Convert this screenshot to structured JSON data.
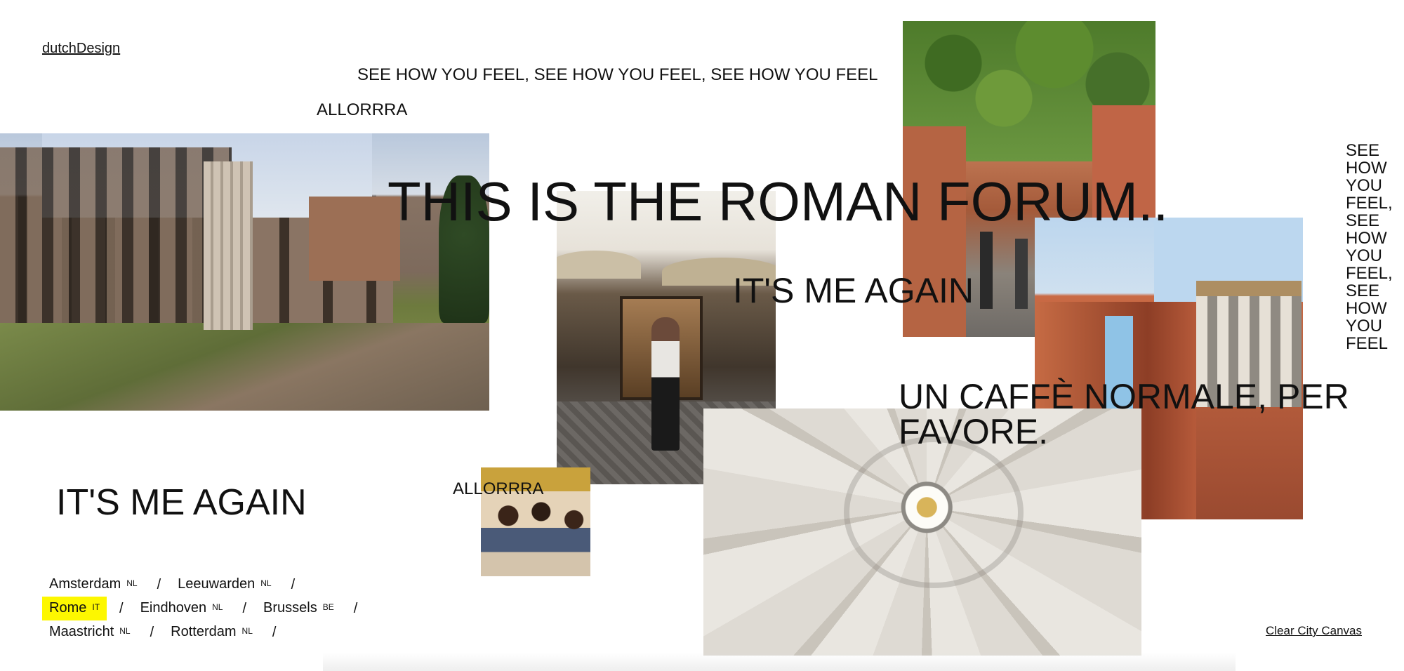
{
  "logo": "dutchDesign",
  "phrases": {
    "see_how_line": "SEE HOW YOU FEEL, SEE HOW YOU FEEL, SEE HOW YOU FEEL",
    "allorrra_top": "ALLORRRA",
    "roman_forum": "THIS IS THE ROMAN FORUM..",
    "me_again_mid": "IT'S ME AGAIN",
    "see_how_vertical": "SEE HOW YOU FEEL, SEE HOW YOU FEEL, SEE HOW YOU FEEL",
    "caffe": "UN CAFFÈ NORMALE, PER FAVORE.",
    "me_again_big": "IT'S ME AGAIN",
    "allorrra_bottom": "ALLORRRA"
  },
  "cities": {
    "active": "Rome",
    "rows": [
      [
        {
          "name": "Amsterdam",
          "code": "NL"
        },
        {
          "name": "Leeuwarden",
          "code": "NL"
        }
      ],
      [
        {
          "name": "Rome",
          "code": "IT"
        },
        {
          "name": "Eindhoven",
          "code": "NL"
        },
        {
          "name": "Brussels",
          "code": "BE"
        }
      ],
      [
        {
          "name": "Maastricht",
          "code": "NL"
        },
        {
          "name": "Rotterdam",
          "code": "NL"
        }
      ]
    ],
    "separator": "/"
  },
  "clear_button": "Clear City Canvas",
  "colors": {
    "highlight": "#fdf700",
    "text": "#111111",
    "background": "#ffffff"
  }
}
